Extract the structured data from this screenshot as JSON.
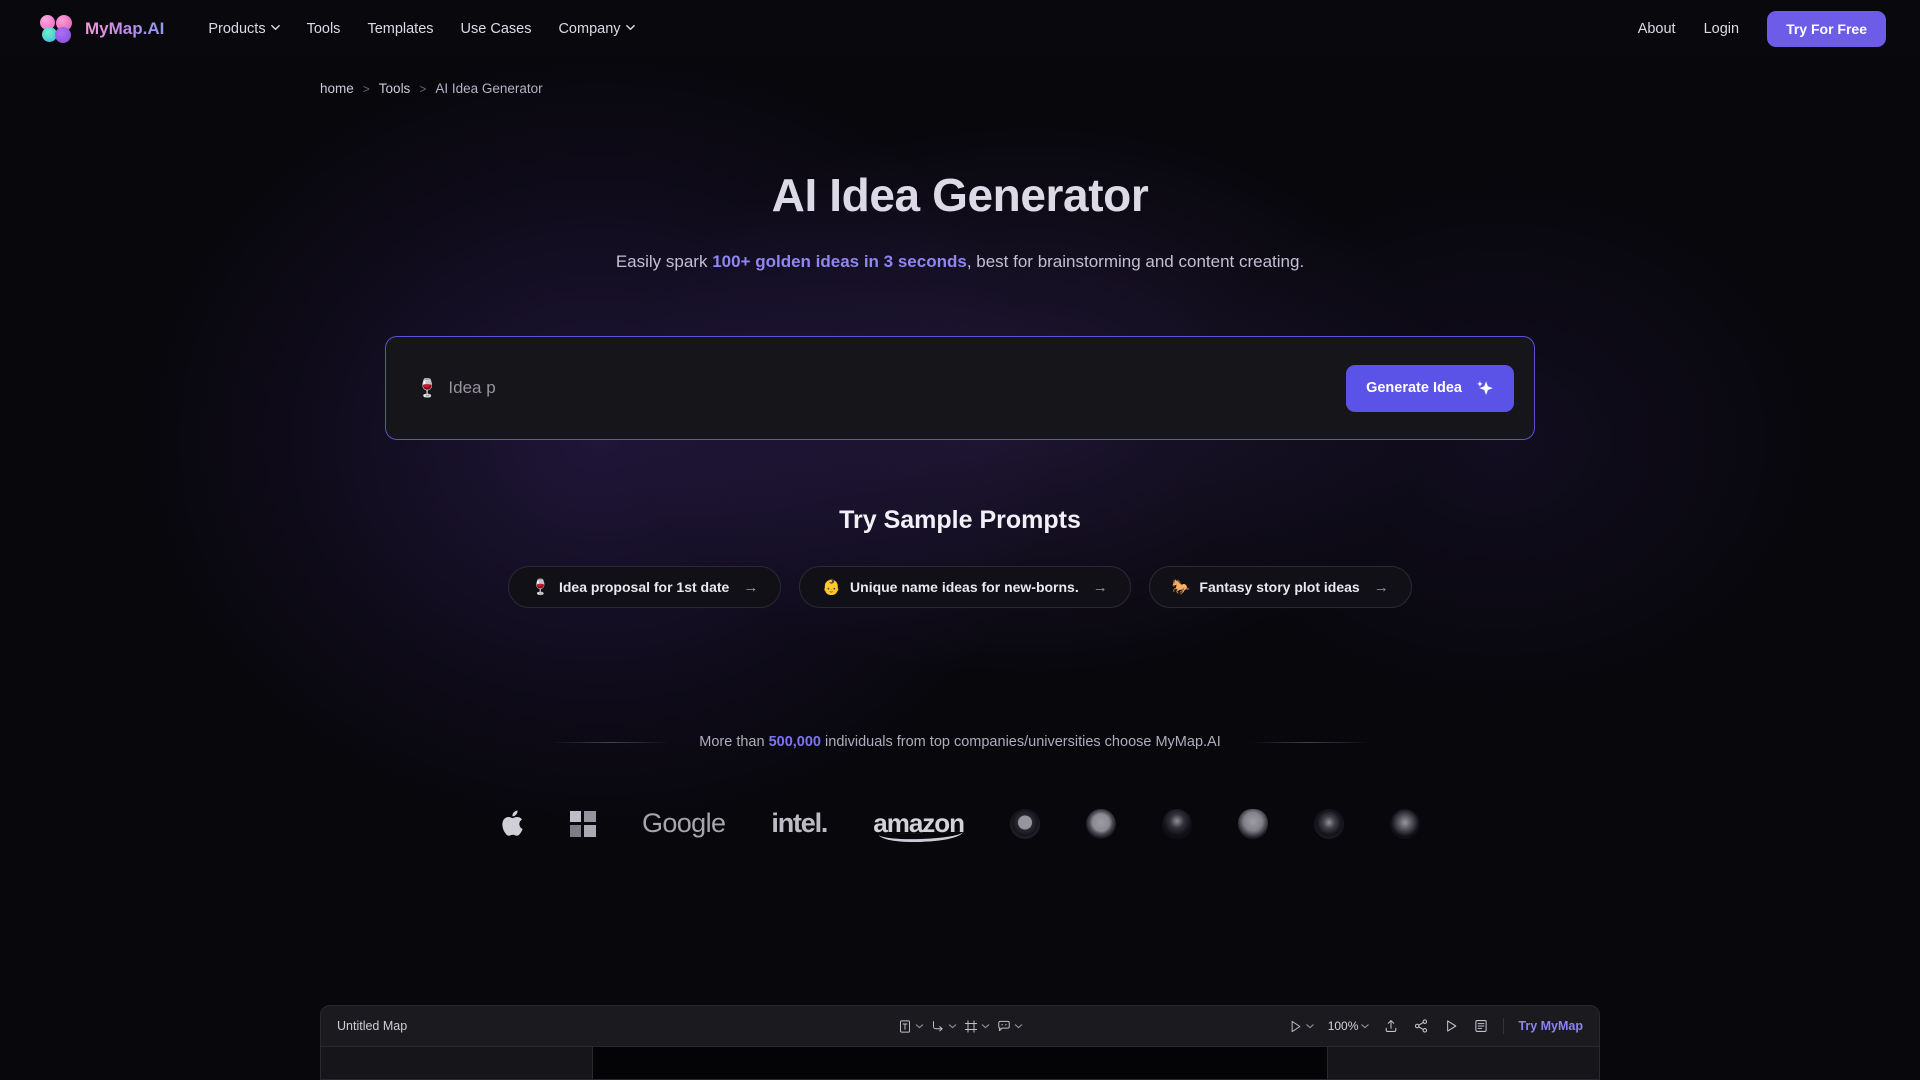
{
  "brand": {
    "name": "MyMap.AI",
    "logo_icon": "mymap-logo-icon"
  },
  "nav": {
    "links": [
      {
        "label": "Products",
        "has_dropdown": true
      },
      {
        "label": "Tools",
        "has_dropdown": false
      },
      {
        "label": "Templates",
        "has_dropdown": false
      },
      {
        "label": "Use Cases",
        "has_dropdown": false
      },
      {
        "label": "Company",
        "has_dropdown": true
      }
    ],
    "right": [
      {
        "label": "About"
      },
      {
        "label": "Login"
      }
    ],
    "cta_label": "Try For Free",
    "cta_color": "#6c5ce8"
  },
  "breadcrumb": {
    "items": [
      "home",
      "Tools",
      "AI Idea Generator"
    ],
    "separator": ">"
  },
  "hero": {
    "title": "AI Idea Generator",
    "subtitle_pre": "Easily spark ",
    "subtitle_highlight": "100+ golden ideas in 3 seconds",
    "subtitle_post": ", best for brainstorming and content creating.",
    "highlight_color": "#8f86f2"
  },
  "prompt_box": {
    "emoji": "🍷",
    "value": "Idea p",
    "button_label": "Generate Idea",
    "button_icon": "sparkle-icon",
    "button_color": "#5b52e8",
    "border_color": "#5b4fd6"
  },
  "samples": {
    "heading": "Try Sample Prompts",
    "items": [
      {
        "emoji": "🍷",
        "label": "Idea proposal for 1st date",
        "arrow": "→"
      },
      {
        "emoji": "👶",
        "label": "Unique name ideas for new-borns.",
        "arrow": "→"
      },
      {
        "emoji": "🐎",
        "label": "Fantasy story plot ideas",
        "arrow": "→"
      }
    ]
  },
  "social_proof": {
    "pre": "More than ",
    "count": "500,000",
    "post": " individuals from top companies/universities choose MyMap.AI",
    "count_color": "#7e74ef",
    "logos": [
      {
        "name": "apple-logo",
        "text": ""
      },
      {
        "name": "microsoft-logo",
        "text": ""
      },
      {
        "name": "google-logo",
        "text": "Google"
      },
      {
        "name": "intel-logo",
        "text": "intel."
      },
      {
        "name": "amazon-logo",
        "text": "amazon"
      },
      {
        "name": "university-seal-1",
        "text": ""
      },
      {
        "name": "university-seal-2",
        "text": ""
      },
      {
        "name": "university-seal-3",
        "text": ""
      },
      {
        "name": "university-seal-4",
        "text": ""
      },
      {
        "name": "university-seal-5",
        "text": ""
      },
      {
        "name": "university-seal-6",
        "text": ""
      }
    ]
  },
  "editor_preview": {
    "title": "Untitled Map",
    "tools": [
      {
        "icon": "text-tool-icon",
        "has_dropdown": true
      },
      {
        "icon": "connector-tool-icon",
        "has_dropdown": true
      },
      {
        "icon": "frame-tool-icon",
        "has_dropdown": true
      },
      {
        "icon": "comment-tool-icon",
        "has_dropdown": true
      }
    ],
    "cursor_icon": "cursor-icon",
    "zoom_level": "100%",
    "right_icons": [
      {
        "icon": "upload-icon"
      },
      {
        "icon": "share-icon"
      },
      {
        "icon": "present-icon"
      },
      {
        "icon": "panel-icon"
      }
    ],
    "try_label": "Try MyMap",
    "try_color": "#8d83f0"
  }
}
